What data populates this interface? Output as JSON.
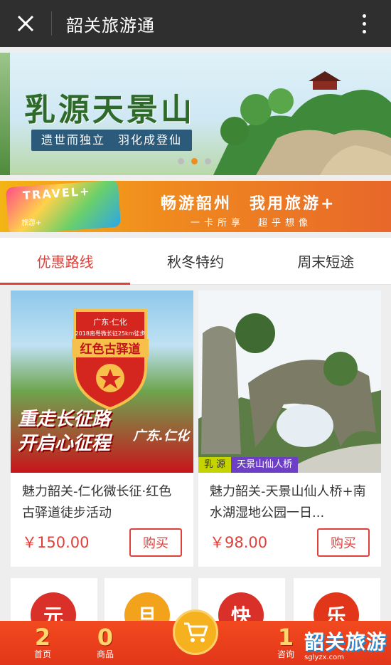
{
  "topbar": {
    "title": "韶关旅游通"
  },
  "hero": {
    "title": "乳源天景山",
    "tagline": "遗世而独立　羽化成登仙",
    "slides": 3,
    "active_slide": 2
  },
  "promo": {
    "card_label": "TRAVEL+",
    "card_mini": "旅游+",
    "slogan": "畅游韶州　我用旅游+",
    "sub": "一卡所享　超乎想像"
  },
  "tabs": [
    {
      "label": "优惠路线",
      "active": true
    },
    {
      "label": "秋冬特约",
      "active": false
    },
    {
      "label": "周末短途",
      "active": false
    }
  ],
  "products": [
    {
      "name": "魅力韶关-仁化微长征·红色古驿道徒步活动",
      "price": "￥150.00",
      "buy": "购买",
      "image": {
        "badge_top": "广东·仁化",
        "badge_sub": "2018南粤微长征25km徒步",
        "badge_main": "红色古驿道",
        "banner_line1": "重走长征路",
        "banner_line2": "开启心征程",
        "place": "广东.仁化"
      }
    },
    {
      "name": "魅力韶关-天景山仙人桥+南水湖湿地公园一日...",
      "price": "￥98.00",
      "buy": "购买",
      "image": {
        "tag1": "乳 源",
        "tag2": "天景山仙人桥"
      }
    }
  ],
  "peek_items": [
    {
      "char": "元",
      "color": "#d9302a"
    },
    {
      "char": "旦",
      "color": "#f3a21c"
    },
    {
      "char": "快",
      "color": "#d9302a"
    },
    {
      "char": "乐",
      "color": "#e2361a"
    }
  ],
  "bottom_nav": {
    "home": {
      "big": "2",
      "label": "首页"
    },
    "goods": {
      "big": "0",
      "label": "商品"
    },
    "consult": {
      "big": "1",
      "label": "咨询"
    }
  },
  "brand": {
    "name": "韶关旅游",
    "url": "sglyzx.com"
  },
  "colors": {
    "accent": "#e0403a",
    "topbar": "#2f2f2f",
    "bottombar": "#e2361a"
  }
}
